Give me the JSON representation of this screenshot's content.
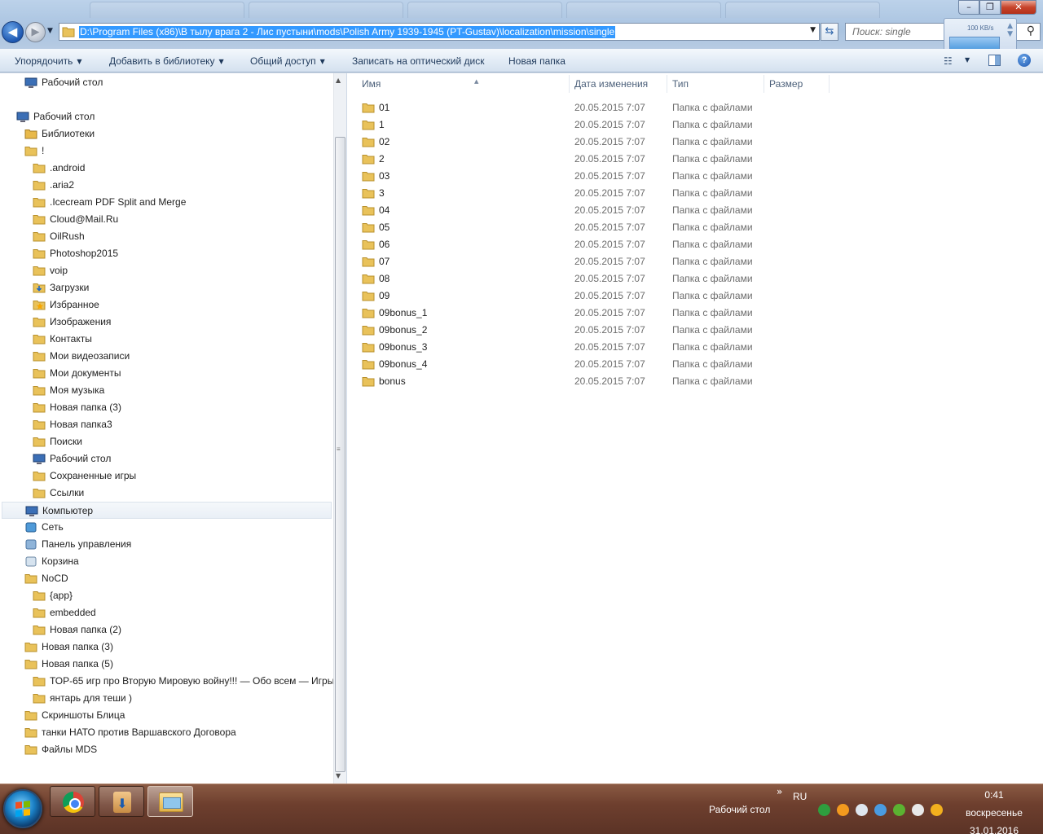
{
  "window": {
    "minimize_icon": "–",
    "maximize_icon": "❐",
    "close_icon": "✕"
  },
  "address_bar": {
    "path": "D:\\Program Files (x86)\\В тылу врага 2 - Лис пустыни\\mods\\Polish Army 1939-1945 (PT-Gustav)\\localization\\mission\\single"
  },
  "search": {
    "placeholder": "Поиск: single"
  },
  "net_widget": {
    "speed": "100 KB/s"
  },
  "toolbar": {
    "organize": "Упорядочить",
    "add_to_library": "Добавить в библиотеку",
    "share": "Общий доступ",
    "burn": "Записать на оптический диск",
    "new_folder": "Новая папка"
  },
  "nav_tree": [
    {
      "label": "Рабочий стол",
      "icon": "desktop-icon",
      "indent": 1
    },
    {
      "label": "",
      "icon": "",
      "indent": 0
    },
    {
      "label": "Рабочий стол",
      "icon": "desktop-icon",
      "indent": 0
    },
    {
      "label": "Библиотеки",
      "icon": "libraries-icon",
      "indent": 1
    },
    {
      "label": "!",
      "icon": "user-folder-icon",
      "indent": 1
    },
    {
      "label": ".android",
      "icon": "folder-icon",
      "indent": 2
    },
    {
      "label": ".aria2",
      "icon": "folder-icon",
      "indent": 2
    },
    {
      "label": ".Icecream PDF Split and Merge",
      "icon": "folder-icon",
      "indent": 2
    },
    {
      "label": "Cloud@Mail.Ru",
      "icon": "folder-icon",
      "indent": 2
    },
    {
      "label": "OilRush",
      "icon": "folder-icon",
      "indent": 2
    },
    {
      "label": "Photoshop2015",
      "icon": "folder-icon",
      "indent": 2
    },
    {
      "label": "voip",
      "icon": "folder-icon",
      "indent": 2
    },
    {
      "label": "Загрузки",
      "icon": "downloads-icon",
      "indent": 2
    },
    {
      "label": "Избранное",
      "icon": "favorites-icon",
      "indent": 2
    },
    {
      "label": "Изображения",
      "icon": "pictures-icon",
      "indent": 2
    },
    {
      "label": "Контакты",
      "icon": "contacts-icon",
      "indent": 2
    },
    {
      "label": "Мои видеозаписи",
      "icon": "videos-icon",
      "indent": 2
    },
    {
      "label": "Мои документы",
      "icon": "documents-icon",
      "indent": 2
    },
    {
      "label": "Моя музыка",
      "icon": "music-icon",
      "indent": 2
    },
    {
      "label": "Новая папка (3)",
      "icon": "folder-icon",
      "indent": 2
    },
    {
      "label": "Новая папка3",
      "icon": "folder-icon",
      "indent": 2
    },
    {
      "label": "Поиски",
      "icon": "searches-icon",
      "indent": 2
    },
    {
      "label": "Рабочий стол",
      "icon": "desktop-icon",
      "indent": 2
    },
    {
      "label": "Сохраненные игры",
      "icon": "saved-games-icon",
      "indent": 2
    },
    {
      "label": "Ссылки",
      "icon": "links-icon",
      "indent": 2
    },
    {
      "label": "Компьютер",
      "icon": "computer-icon",
      "indent": 1,
      "selected": true
    },
    {
      "label": "Сеть",
      "icon": "network-icon",
      "indent": 1
    },
    {
      "label": "Панель управления",
      "icon": "control-panel-icon",
      "indent": 1
    },
    {
      "label": "Корзина",
      "icon": "recycle-bin-icon",
      "indent": 1
    },
    {
      "label": "NoCD",
      "icon": "folder-icon",
      "indent": 1
    },
    {
      "label": "{app}",
      "icon": "folder-icon",
      "indent": 2
    },
    {
      "label": "embedded",
      "icon": "folder-icon",
      "indent": 2
    },
    {
      "label": "Новая папка (2)",
      "icon": "folder-icon",
      "indent": 2
    },
    {
      "label": "Новая папка (3)",
      "icon": "folder-icon",
      "indent": 1
    },
    {
      "label": "Новая папка (5)",
      "icon": "folder-icon",
      "indent": 1
    },
    {
      "label": "ТОР-65 игр про Вторую Мировую войну!!! — Обо всем — Игры",
      "icon": "folder-icon",
      "indent": 2
    },
    {
      "label": "янтарь  для теши )",
      "icon": "folder-icon",
      "indent": 2
    },
    {
      "label": "Скриншоты Блица",
      "icon": "folder-icon",
      "indent": 1
    },
    {
      "label": "танки НАТО против Варшавского Договора",
      "icon": "folder-icon",
      "indent": 1
    },
    {
      "label": "Файлы MDS",
      "icon": "folder-icon",
      "indent": 1
    }
  ],
  "columns": {
    "name": "Имя",
    "date": "Дата изменения",
    "type": "Тип",
    "size": "Размер"
  },
  "files": [
    {
      "name": "01",
      "date": "20.05.2015 7:07",
      "type": "Папка с файлами"
    },
    {
      "name": "1",
      "date": "20.05.2015 7:07",
      "type": "Папка с файлами"
    },
    {
      "name": "02",
      "date": "20.05.2015 7:07",
      "type": "Папка с файлами"
    },
    {
      "name": "2",
      "date": "20.05.2015 7:07",
      "type": "Папка с файлами"
    },
    {
      "name": "03",
      "date": "20.05.2015 7:07",
      "type": "Папка с файлами"
    },
    {
      "name": "3",
      "date": "20.05.2015 7:07",
      "type": "Папка с файлами"
    },
    {
      "name": "04",
      "date": "20.05.2015 7:07",
      "type": "Папка с файлами"
    },
    {
      "name": "05",
      "date": "20.05.2015 7:07",
      "type": "Папка с файлами"
    },
    {
      "name": "06",
      "date": "20.05.2015 7:07",
      "type": "Папка с файлами"
    },
    {
      "name": "07",
      "date": "20.05.2015 7:07",
      "type": "Папка с файлами"
    },
    {
      "name": "08",
      "date": "20.05.2015 7:07",
      "type": "Папка с файлами"
    },
    {
      "name": "09",
      "date": "20.05.2015 7:07",
      "type": "Папка с файлами"
    },
    {
      "name": "09bonus_1",
      "date": "20.05.2015 7:07",
      "type": "Папка с файлами"
    },
    {
      "name": "09bonus_2",
      "date": "20.05.2015 7:07",
      "type": "Папка с файлами"
    },
    {
      "name": "09bonus_3",
      "date": "20.05.2015 7:07",
      "type": "Папка с файлами"
    },
    {
      "name": "09bonus_4",
      "date": "20.05.2015 7:07",
      "type": "Папка с файлами"
    },
    {
      "name": "bonus",
      "date": "20.05.2015 7:07",
      "type": "Папка с файлами"
    }
  ],
  "taskbar": {
    "desktop_label": "Рабочий стол",
    "chevron": "»",
    "language": "RU",
    "time": "0:41",
    "weekday": "воскресенье",
    "date": "31.01.2016",
    "tray_icons": [
      {
        "name": "green-sync-icon",
        "color": "#2e9e3e"
      },
      {
        "name": "orange-update-icon",
        "color": "#f39a1e"
      },
      {
        "name": "monitor-icon",
        "color": "#dfe6ee"
      },
      {
        "name": "download-arrow-icon",
        "color": "#4a9be0"
      },
      {
        "name": "utorrent-icon",
        "color": "#5bb231"
      },
      {
        "name": "volume-icon",
        "color": "#e8e8e8"
      },
      {
        "name": "yellow-app-icon",
        "color": "#f2b01e"
      }
    ]
  },
  "colors": {
    "folder": "#e9c25a",
    "selection": "#3399ff",
    "link_text": "#1e395b"
  }
}
